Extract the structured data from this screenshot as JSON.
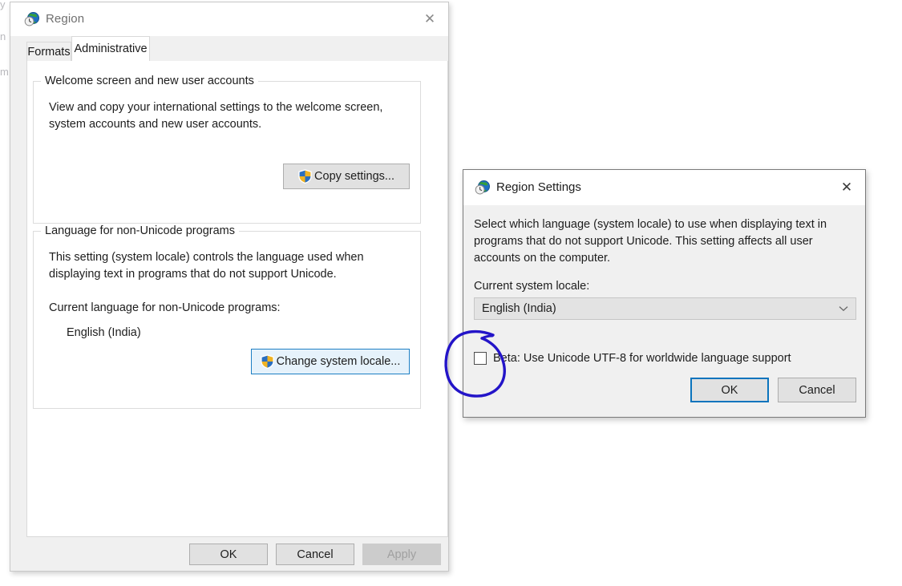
{
  "background": {
    "fragments": [
      "y",
      "n",
      "m"
    ]
  },
  "region_window": {
    "title": "Region",
    "title_icon": "region-globe-clock-icon",
    "close_icon": "close-icon",
    "tabs": [
      {
        "label": "Formats",
        "active": false
      },
      {
        "label": "Administrative",
        "active": true
      }
    ],
    "welcome_group": {
      "legend": "Welcome screen and new user accounts",
      "description_line1": "View and copy your international settings to the welcome screen,",
      "description_line2": "system accounts and new user accounts.",
      "copy_settings_button": "Copy settings...",
      "copy_settings_icon": "uac-shield-icon"
    },
    "locale_group": {
      "legend": "Language for non-Unicode programs",
      "description_line1": "This setting (system locale) controls the language used when",
      "description_line2": "displaying text in programs that do not support Unicode.",
      "current_label": "Current language for non-Unicode programs:",
      "current_value": "English (India)",
      "change_locale_button": "Change system locale...",
      "change_locale_icon": "uac-shield-icon"
    },
    "footer": {
      "ok": "OK",
      "cancel": "Cancel",
      "apply": "Apply",
      "apply_disabled": true
    }
  },
  "region_settings_dialog": {
    "title": "Region Settings",
    "title_icon": "region-globe-clock-icon",
    "close_icon": "close-icon",
    "description_line1": "Select which language (system locale) to use when displaying text in",
    "description_line2": "programs that do not support Unicode. This setting affects all user",
    "description_line3": "accounts on the computer.",
    "locale_label": "Current system locale:",
    "locale_value": "English (India)",
    "dropdown_icon": "chevron-down-icon",
    "beta_checkbox_label": "Beta: Use Unicode UTF-8 for worldwide language support",
    "beta_checkbox_checked": false,
    "ok": "OK",
    "cancel": "Cancel"
  },
  "annotation": {
    "type": "hand-drawn-circle",
    "color": "#2314c8",
    "target": "beta-utf8-checkbox"
  },
  "colors": {
    "window_bg": "#f0f0f0",
    "page_bg": "#ffffff",
    "text": "#1d1d1d",
    "title_grey": "#6f6f6f",
    "focus_blue": "#1d7fc4",
    "default_btn_blue": "#0a74bd",
    "ink_blue": "#2314c8",
    "disabled_text": "#a0a0a0"
  }
}
